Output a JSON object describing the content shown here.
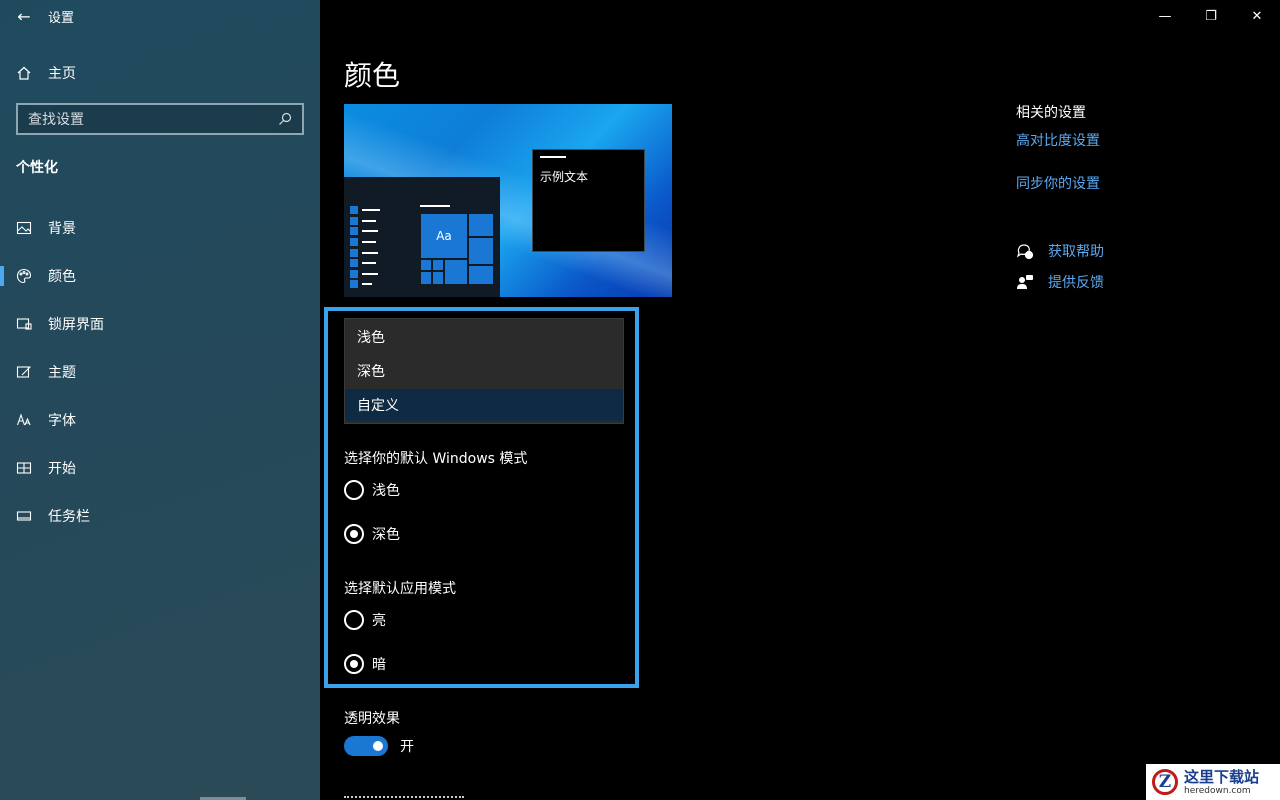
{
  "window": {
    "back_glyph": "←",
    "title": "设置",
    "minimize_glyph": "—",
    "restore_glyph": "❐",
    "close_glyph": "✕"
  },
  "sidebar": {
    "home_label": "主页",
    "search_placeholder": "查找设置",
    "section_title": "个性化",
    "items": [
      {
        "label": "背景",
        "icon": "image-icon",
        "active": false
      },
      {
        "label": "颜色",
        "icon": "palette-icon",
        "active": true
      },
      {
        "label": "锁屏界面",
        "icon": "lock-screen-icon",
        "active": false
      },
      {
        "label": "主题",
        "icon": "theme-brush-icon",
        "active": false
      },
      {
        "label": "字体",
        "icon": "font-icon",
        "active": false
      },
      {
        "label": "开始",
        "icon": "start-menu-icon",
        "active": false
      },
      {
        "label": "任务栏",
        "icon": "taskbar-icon",
        "active": false
      }
    ]
  },
  "main": {
    "page_title": "颜色",
    "preview": {
      "sample_text": "示例文本",
      "tile_label": "Aa"
    },
    "color_dropdown": {
      "options": [
        "浅色",
        "深色",
        "自定义"
      ],
      "selected": "自定义"
    },
    "windows_mode": {
      "label": "选择你的默认 Windows 模式",
      "options": [
        {
          "label": "浅色",
          "checked": false
        },
        {
          "label": "深色",
          "checked": true
        }
      ]
    },
    "app_mode": {
      "label": "选择默认应用模式",
      "options": [
        {
          "label": "亮",
          "checked": false
        },
        {
          "label": "暗",
          "checked": true
        }
      ]
    },
    "transparency": {
      "label": "透明效果",
      "state_label": "开",
      "on": true
    }
  },
  "related": {
    "heading": "相关的设置",
    "links": [
      "高对比度设置",
      "同步你的设置"
    ],
    "help": [
      {
        "label": "获取帮助",
        "icon": "help-chat-icon"
      },
      {
        "label": "提供反馈",
        "icon": "feedback-icon"
      }
    ]
  },
  "watermark": {
    "logo_letter": "Z",
    "name": "这里下载站",
    "domain": "heredown.com"
  },
  "colors": {
    "accent": "#1a78d4",
    "link": "#5aa9f0",
    "highlight_border": "#3aa3ec"
  }
}
